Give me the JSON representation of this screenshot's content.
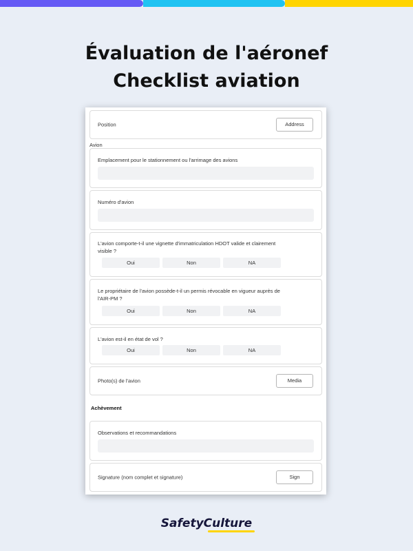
{
  "header": {
    "title_line1": "Évaluation de l'aéronef",
    "title_line2": "Checklist aviation"
  },
  "colors": {
    "bar_purple": "#6559f5",
    "bar_cyan": "#20c3f2",
    "bar_yellow": "#ffd400"
  },
  "form": {
    "position": {
      "label": "Position",
      "button": "Address"
    },
    "section_avion": "Avion",
    "emplacement": {
      "label": "Emplacement pour le stationnement ou l'arrimage des avions"
    },
    "numero": {
      "label": "Numéro d'avion"
    },
    "q1": {
      "label": "L'avion comporte-t-il une vignette d'immatriculation HDOT valide et clairement visible ?",
      "options": [
        "Oui",
        "Non",
        "NA"
      ]
    },
    "q2": {
      "label": "Le propriétaire de l'avion possède-t-il un permis révocable en vigueur auprès de l'AIR-PM ?",
      "options": [
        "Oui",
        "Non",
        "NA"
      ]
    },
    "q3": {
      "label": "L'avion est-il en état de vol ?",
      "options": [
        "Oui",
        "Non",
        "NA"
      ]
    },
    "photos": {
      "label": "Photo(s) de l'avion",
      "button": "Media"
    },
    "section_achevement": "Achèvement",
    "observations": {
      "label": "Observations et recommandations"
    },
    "signature": {
      "label": "Signature (nom complet et signature)",
      "button": "Sign"
    }
  },
  "footer": {
    "brand": "SafetyCulture"
  }
}
